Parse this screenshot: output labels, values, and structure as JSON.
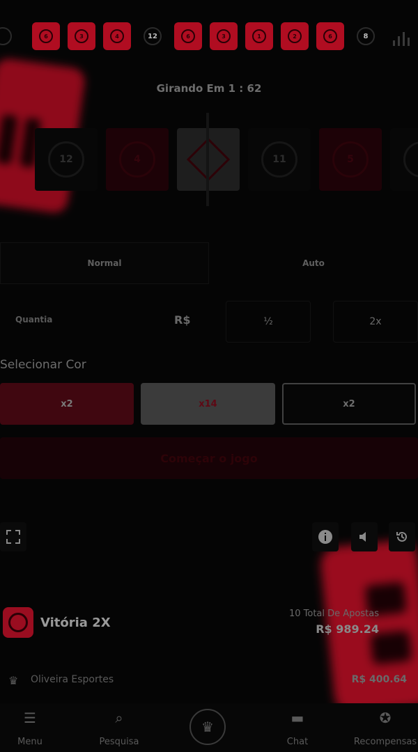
{
  "history": [
    {
      "color": "black",
      "number": "",
      "edge": true
    },
    {
      "color": "red",
      "number": "6"
    },
    {
      "color": "red",
      "number": "3"
    },
    {
      "color": "red",
      "number": "4"
    },
    {
      "color": "black",
      "number": "12"
    },
    {
      "color": "red",
      "number": "6"
    },
    {
      "color": "red",
      "number": "3"
    },
    {
      "color": "red",
      "number": "1"
    },
    {
      "color": "red",
      "number": "2"
    },
    {
      "color": "red",
      "number": "6"
    },
    {
      "color": "black",
      "number": "8"
    }
  ],
  "spinner": {
    "title": "Girando Em 1 : 62",
    "tiles": [
      {
        "color": "black",
        "number": "12"
      },
      {
        "color": "red",
        "number": "4"
      },
      {
        "color": "white",
        "number": ""
      },
      {
        "color": "black",
        "number": "11"
      },
      {
        "color": "red",
        "number": "5"
      },
      {
        "color": "black",
        "number": ""
      }
    ]
  },
  "modes": {
    "normal": "Normal",
    "auto": "Auto"
  },
  "amount": {
    "label": "Quantia",
    "currency": "R$",
    "half": "½",
    "double": "2x"
  },
  "colors": {
    "label": "Selecionar Cor",
    "red": "x2",
    "white": "x14",
    "black": "x2"
  },
  "start_label": "Começar o jogo",
  "controls": {
    "fullscreen_icon": "fullscreen-icon",
    "info_icon": "info-icon",
    "sound_icon": "volume-icon",
    "history_icon": "history-icon"
  },
  "win": {
    "title": "Vitória 2X",
    "total_bets": "10 Total De Apostas",
    "amount": "R$ 989.24"
  },
  "bettor": {
    "name": "Oliveira Esportes",
    "amount": "R$ 400.64"
  },
  "nav": {
    "menu": "Menu",
    "search": "Pesquisa",
    "chat": "Chat",
    "rewards": "Recompensas"
  },
  "accent": "#b00d21"
}
